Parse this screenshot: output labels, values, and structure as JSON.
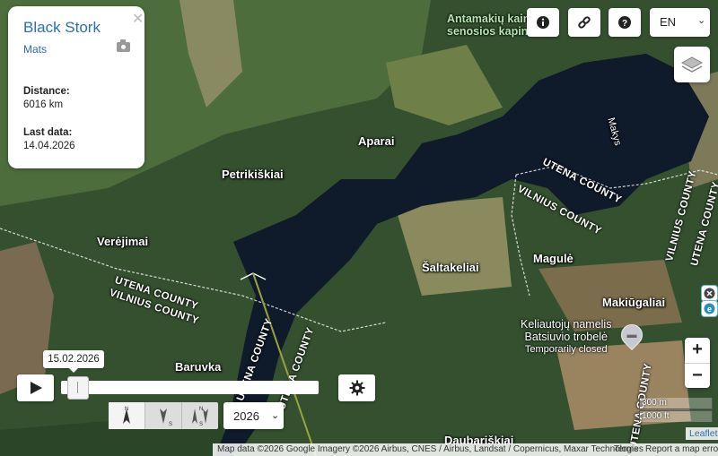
{
  "info": {
    "title": "Black Stork",
    "owner": "Mats",
    "distance_label": "Distance:",
    "distance_value": "6016 km",
    "last_label": "Last data:",
    "last_value": "14.04.2026"
  },
  "toolbar": {
    "info_icon": "info-icon",
    "link_icon": "link-icon",
    "help_icon": "help-icon",
    "language": "EN"
  },
  "map": {
    "places": [
      "Petrikiškiai",
      "Aparai",
      "Verėjimai",
      "Baruvka",
      "Šaltakeliai",
      "Magulė",
      "Makiūgaliai",
      "Daubariškiai",
      "Makys"
    ],
    "counties": [
      "UTENA COUNTY",
      "VILNIUS COUNTY"
    ],
    "poi_top_line1": "Antamakių kaim",
    "poi_top_line2": "senosios kapinė",
    "poi_line1": "Keliautojų namelis",
    "poi_line2": "Batsiuvio trobelė",
    "poi_status": "Temporarily closed",
    "colors": {
      "lake": "#0f1a2a",
      "forest": "#1f3a22",
      "field": "#5f7a48",
      "track": "#9aa33a"
    }
  },
  "timeline": {
    "date_tooltip": "15.02.2026",
    "progress": 0.0,
    "year": "2026"
  },
  "scale": {
    "metric": "300 m",
    "imperial": "1000 ft"
  },
  "attribution": {
    "leaflet": "Leaflet",
    "map_data": "Map data ©2026 Google Imagery ©2026 Airbus, CNES / Airbus, Landsat / Copernicus, Maxar Technologies",
    "terms": "Terms",
    "report": "Report a map error"
  }
}
